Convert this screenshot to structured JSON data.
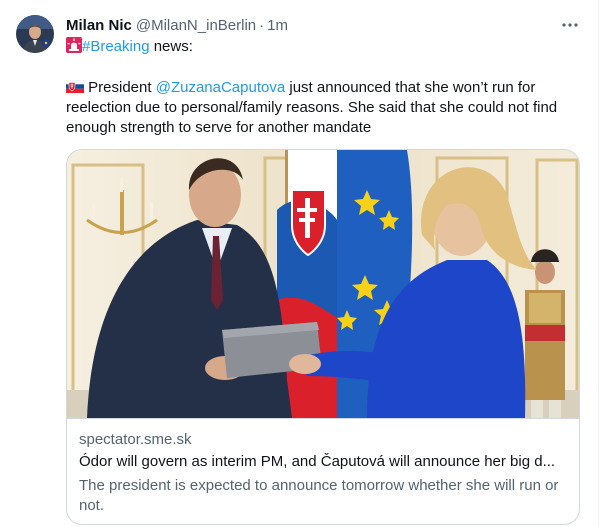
{
  "author": {
    "name": "Milan Nic",
    "handle": "@MilanN_inBerlin",
    "separator": "·",
    "time": "1m"
  },
  "tweet": {
    "line1_emoji_icon": "siren-icon",
    "hashtag": "#Breaking",
    "line1_rest": " news:",
    "flag_icon": "slovakia-flag-icon",
    "text_before_mention": " President ",
    "mention": "@ZuzanaCaputova",
    "text_after_mention": " just announced that she won’t run for reelection due to personal/family reasons. She said that she could not find enough strength to serve for another mandate"
  },
  "card": {
    "domain": "spectator.sme.sk",
    "title": "Ódor will govern as interim PM, and Čaputová will announce her big d...",
    "description": "The president is expected to announce tomorrow whether she will run or not."
  },
  "icons": {
    "more": "more-horizontal-icon"
  },
  "colors": {
    "accent": "#1d9bf0",
    "secondary_text": "#536471",
    "card_border": "#cfd9de"
  }
}
